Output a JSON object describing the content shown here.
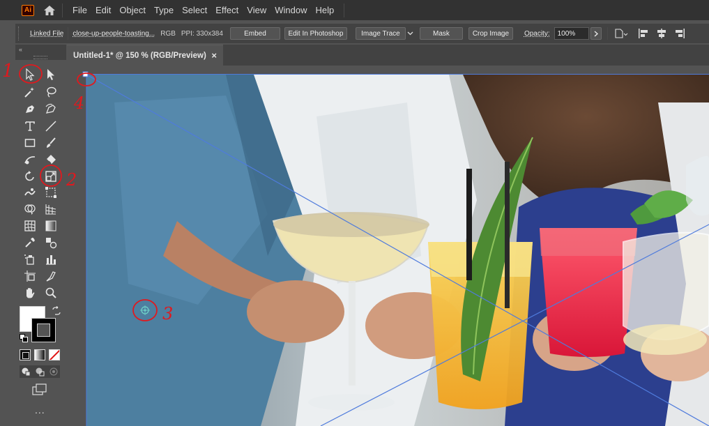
{
  "menubar": {
    "logo_text": "Ai",
    "items": [
      "File",
      "Edit",
      "Object",
      "Type",
      "Select",
      "Effect",
      "View",
      "Window",
      "Help"
    ]
  },
  "control_bar": {
    "linked_file": "Linked File",
    "file_name": "close-up-people-toasting...",
    "color_mode": "RGB",
    "ppi": "PPI: 330x384",
    "embed": "Embed",
    "edit_in_photoshop": "Edit In Photoshop",
    "image_trace": "Image Trace",
    "mask": "Mask",
    "crop_image": "Crop Image",
    "opacity_label": "Opacity:",
    "opacity_value": "100%"
  },
  "document": {
    "tab_title": "Untitled-1* @ 150 % (RGB/Preview)",
    "close_glyph": "×"
  },
  "annotations": [
    "1",
    "2",
    "3",
    "4"
  ],
  "toolbar_more": "...",
  "colors": {
    "accent": "#ff7c00",
    "annotation_red": "#e0191e",
    "selection_blue": "#4f7bdc",
    "panel_bg": "#535353",
    "menu_bg": "#323232"
  }
}
